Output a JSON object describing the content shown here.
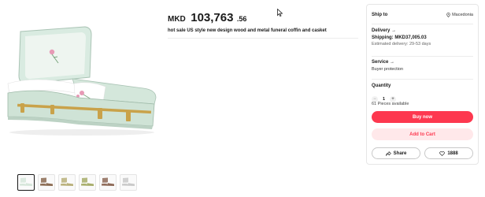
{
  "product": {
    "price_currency": "MKD",
    "price_integer": "103,763",
    "price_decimal": ".56",
    "title": "hot sale US style new design wood and metal funeral coffin and casket"
  },
  "gallery": {
    "thumbnail_count": 6,
    "selected_index": 0,
    "main_image_icon": "casket-photo",
    "thumbnail_colors": [
      "#d6e6da",
      "#8b6b52",
      "#b9b07a",
      "#a7ad6a",
      "#8e6a58",
      "#c9c9c9"
    ]
  },
  "panel": {
    "ship_to_label": "Ship to",
    "ship_to_value": "Macedonia",
    "ship_to_icon": "location-pin-icon",
    "delivery_label": "Delivery",
    "shipping_cost": "Shipping: MKD37,005.03",
    "estimated_delivery": "Estimated delivery: 29-53 days",
    "service_label": "Service",
    "service_value": "Buyer protection",
    "quantity_label": "Quantity",
    "quantity_value": "1",
    "decrement_symbol": "−",
    "increment_symbol": "+",
    "pieces_available": "61 Pieces available",
    "buy_now_label": "Buy now",
    "add_to_cart_label": "Add to Cart",
    "share_label": "Share",
    "wishlist_count": "1888"
  },
  "colors": {
    "accent": "#fd384f",
    "accent_light": "#ffe8ea",
    "casket_body": "#d8e9df"
  }
}
